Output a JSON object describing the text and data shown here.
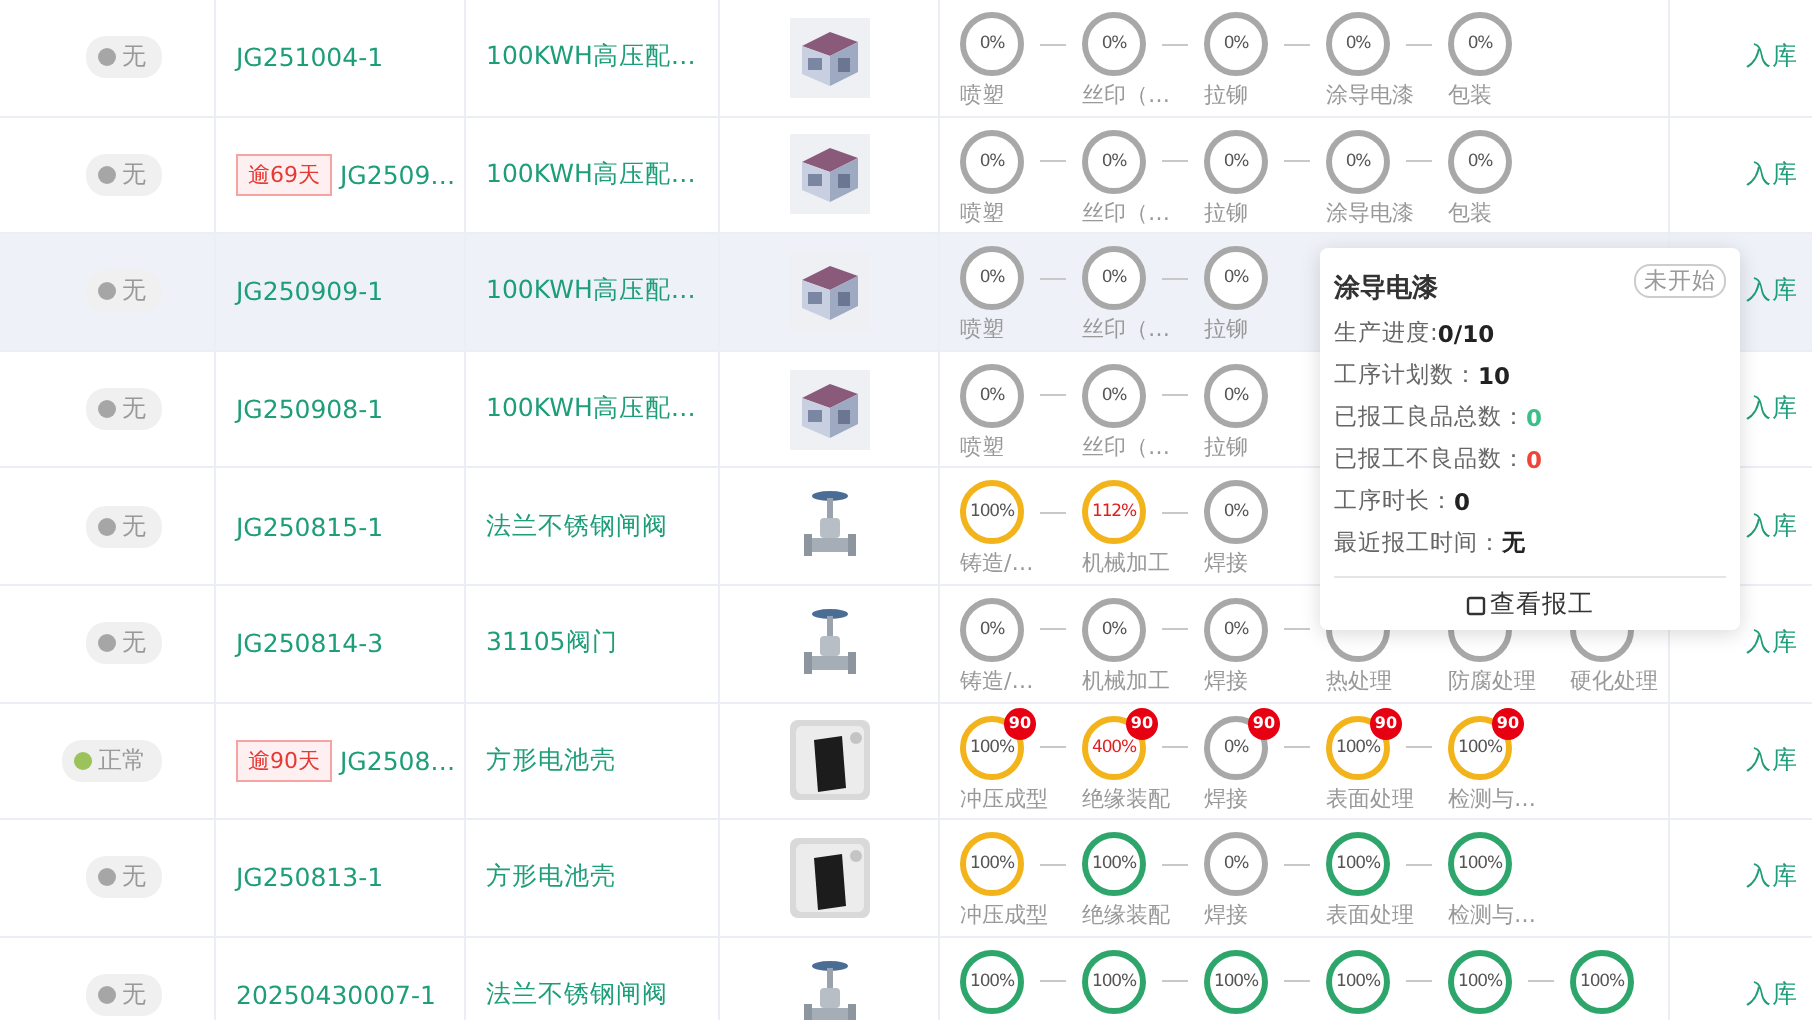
{
  "rows": [
    {
      "status": {
        "text": "无",
        "color": "#a6a6a6"
      },
      "order": "JG251004-1",
      "product": "100KWH高压配…",
      "image": {
        "kind": "picture"
      },
      "highlighted": false,
      "steps": [
        {
          "value": "0%",
          "kind": "idle",
          "label": "喷塑"
        },
        {
          "value": "0%",
          "kind": "idle",
          "label": "丝印（…"
        },
        {
          "value": "0%",
          "kind": "idle",
          "label": "拉铆"
        },
        {
          "value": "0%",
          "kind": "idle",
          "label": "涂导电漆"
        },
        {
          "value": "0%",
          "kind": "idle",
          "label": "包装"
        }
      ],
      "action": "入库"
    },
    {
      "status": {
        "text": "无",
        "color": "#a6a6a6"
      },
      "overdue": "逾69天",
      "order": "JG2509…",
      "product": "100KWH高压配…",
      "image": {
        "kind": "picture"
      },
      "highlighted": false,
      "steps": [
        {
          "value": "0%",
          "kind": "idle",
          "label": "喷塑"
        },
        {
          "value": "0%",
          "kind": "idle",
          "label": "丝印（…"
        },
        {
          "value": "0%",
          "kind": "idle",
          "label": "拉铆"
        },
        {
          "value": "0%",
          "kind": "idle",
          "label": "涂导电漆"
        },
        {
          "value": "0%",
          "kind": "idle",
          "label": "包装"
        }
      ],
      "action": "入库"
    },
    {
      "status": {
        "text": "无",
        "color": "#a6a6a6"
      },
      "order": "JG250909-1",
      "product": "100KWH高压配…",
      "image": {
        "kind": "picture"
      },
      "highlighted": true,
      "steps": [
        {
          "value": "0%",
          "kind": "idle",
          "label": "喷塑"
        },
        {
          "value": "0%",
          "kind": "idle",
          "label": "丝印（…"
        },
        {
          "value": "0%",
          "kind": "idle",
          "label": "拉铆"
        }
      ],
      "action": "入库"
    },
    {
      "status": {
        "text": "无",
        "color": "#a6a6a6"
      },
      "order": "JG250908-1",
      "product": "100KWH高压配…",
      "image": {
        "kind": "picture"
      },
      "highlighted": false,
      "steps": [
        {
          "value": "0%",
          "kind": "idle",
          "label": "喷塑"
        },
        {
          "value": "0%",
          "kind": "idle",
          "label": "丝印（…"
        },
        {
          "value": "0%",
          "kind": "idle",
          "label": "拉铆"
        }
      ],
      "action": "入库"
    },
    {
      "status": {
        "text": "无",
        "color": "#a6a6a6"
      },
      "order": "JG250815-1",
      "product": "法兰不锈钢闸阀",
      "image": {
        "kind": "picture"
      },
      "highlighted": false,
      "steps": [
        {
          "value": "100%",
          "kind": "active",
          "label": "铸造/…"
        },
        {
          "value": "112%",
          "kind": "over",
          "label": "机械加工"
        },
        {
          "value": "0%",
          "kind": "idle",
          "label": "焊接"
        }
      ],
      "action": "入库"
    },
    {
      "status": {
        "text": "无",
        "color": "#a6a6a6"
      },
      "order": "JG250814-3",
      "product": "31105阀门",
      "image": {
        "kind": "picture"
      },
      "highlighted": false,
      "steps": [
        {
          "value": "0%",
          "kind": "idle",
          "label": "铸造/…"
        },
        {
          "value": "0%",
          "kind": "idle",
          "label": "机械加工"
        },
        {
          "value": "0%",
          "kind": "idle",
          "label": "焊接"
        },
        {
          "kind": "idle",
          "label": "热处理"
        },
        {
          "kind": "idle",
          "label": "防腐处理"
        },
        {
          "kind": "idle",
          "label": "硬化处理"
        }
      ],
      "action": "入库"
    },
    {
      "status": {
        "text": "正常",
        "color": "#9bc25b"
      },
      "overdue": "逾90天",
      "order": "JG2508…",
      "product": "方形电池壳",
      "image": {
        "kind": "picture"
      },
      "highlighted": false,
      "steps": [
        {
          "value": "100%",
          "kind": "active",
          "label": "冲压成型",
          "badge": "90"
        },
        {
          "value": "400%",
          "kind": "over",
          "label": "绝缘装配",
          "badge": "90"
        },
        {
          "value": "0%",
          "kind": "idle",
          "label": "焊接",
          "badge": "90"
        },
        {
          "value": "100%",
          "kind": "active",
          "label": "表面处理",
          "badge": "90"
        },
        {
          "value": "100%",
          "kind": "active",
          "label": "检测与…",
          "badge": "90"
        }
      ],
      "action": "入库"
    },
    {
      "status": {
        "text": "无",
        "color": "#a6a6a6"
      },
      "order": "JG250813-1",
      "product": "方形电池壳",
      "image": {
        "kind": "picture"
      },
      "highlighted": false,
      "steps": [
        {
          "value": "100%",
          "kind": "active",
          "label": "冲压成型"
        },
        {
          "value": "100%",
          "kind": "done",
          "label": "绝缘装配"
        },
        {
          "value": "0%",
          "kind": "idle",
          "label": "焊接"
        },
        {
          "value": "100%",
          "kind": "done",
          "label": "表面处理"
        },
        {
          "value": "100%",
          "kind": "done",
          "label": "检测与…"
        }
      ],
      "action": "入库"
    },
    {
      "status": {
        "text": "无",
        "color": "#a6a6a6"
      },
      "order": "20250430007-1",
      "product": "法兰不锈钢闸阀",
      "image": {
        "kind": "picture"
      },
      "highlighted": false,
      "steps": [
        {
          "value": "100%",
          "kind": "done"
        },
        {
          "value": "100%",
          "kind": "done"
        },
        {
          "value": "100%",
          "kind": "done"
        },
        {
          "value": "100%",
          "kind": "done"
        },
        {
          "value": "100%",
          "kind": "done"
        },
        {
          "value": "100%",
          "kind": "done"
        }
      ],
      "action": "入库"
    }
  ],
  "tooltip": {
    "title": "涂导电漆",
    "tag": "未开始",
    "fields": [
      {
        "label": "生产进度:",
        "value": "0/10",
        "kind": "default"
      },
      {
        "label": "工序计划数：",
        "value": "10",
        "kind": "default"
      },
      {
        "label": "已报工良品总数：",
        "value": "0",
        "kind": "good"
      },
      {
        "label": "已报工不良品数：",
        "value": "0",
        "kind": "bad"
      },
      {
        "label": "工序时长：",
        "value": "0",
        "kind": "default"
      },
      {
        "label": "最近报工时间：",
        "value": "无",
        "kind": "default"
      }
    ],
    "button": "查看报工"
  }
}
